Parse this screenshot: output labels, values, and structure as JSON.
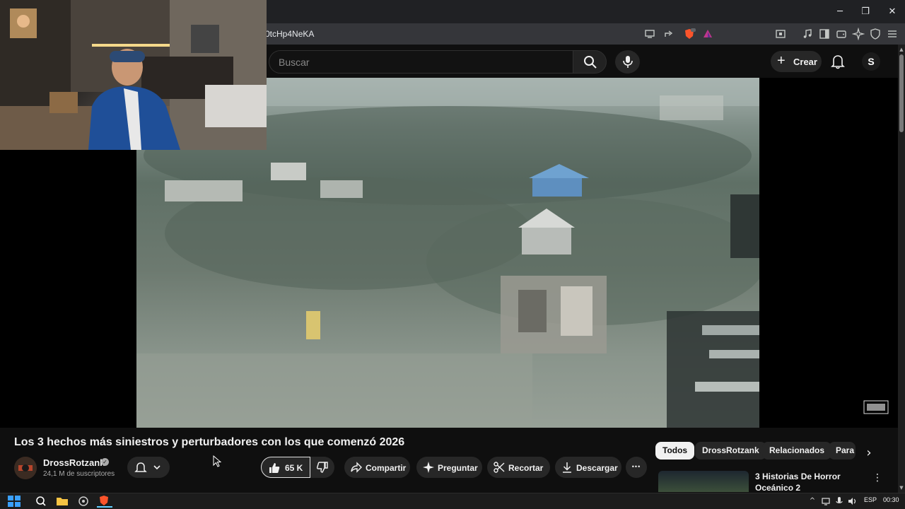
{
  "browser": {
    "url_fragment": "0tcHp4NeKA",
    "window_controls": {
      "minimize": "─",
      "maximize": "❐",
      "close": "✕"
    }
  },
  "header": {
    "search_placeholder": "Buscar",
    "create_label": "Crear",
    "create_plus": "+",
    "account_initial": "S"
  },
  "video": {
    "title": "Los 3 hechos más siniestros y perturbadores con los que comenzó 2026"
  },
  "channel": {
    "name": "DrossRotzank",
    "subscribers": "24,1 M de suscriptores",
    "verified_mark": "✓"
  },
  "actions": {
    "likes": "65 K",
    "share": "Compartir",
    "ask": "Preguntar",
    "clip": "Recortar",
    "download": "Descargar",
    "more": "•••"
  },
  "chips": {
    "items": [
      "Todos",
      "DrossRotzank",
      "Relacionados",
      "Para"
    ],
    "next_arrow": "›"
  },
  "recommendation": {
    "title": "3 Historias De Horror Oceánico 2",
    "menu": "⋮"
  },
  "taskbar": {
    "language": "ESP",
    "time": "00:30",
    "tray_chevron": "^"
  },
  "colors": {
    "page_bg": "#0f0f0f",
    "chip_active_bg": "#f1f1f1",
    "button_bg": "#272727",
    "brave_orange": "#fb542b"
  }
}
